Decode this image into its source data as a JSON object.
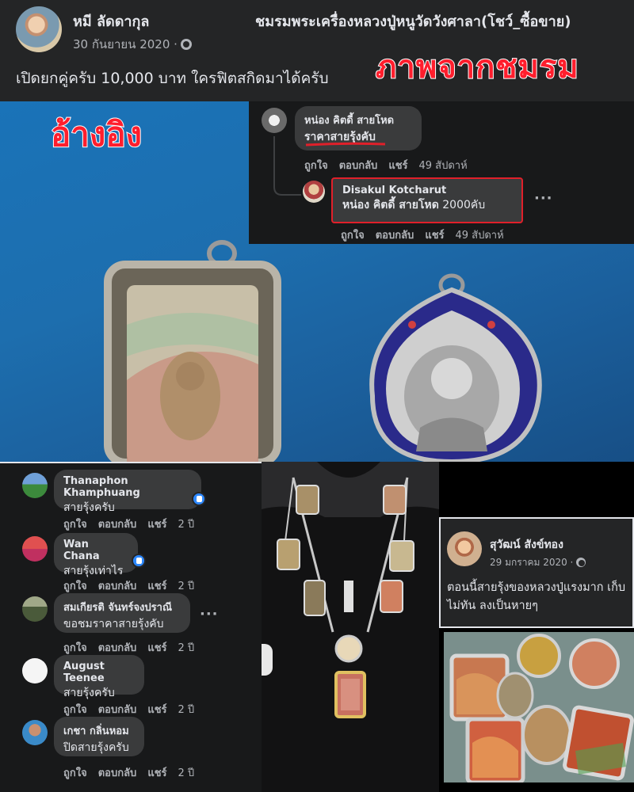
{
  "top_post": {
    "author": "หมี ลัดดากุล",
    "date": "30 กันยายน 2020 ·",
    "group": "ชมรมพระเครื่องหลวงปู่หนูวัดวังศาลา(โชว์_ซื้อขาย)",
    "text": "เปิดยกคู่ครับ 10,000 บาท ใครฟิตสกิดมาได้ครับ",
    "overlay_label": "ภาพจากชมรม"
  },
  "main_photo": {
    "overlay_label": "อ้างอิง"
  },
  "top_comments": [
    {
      "name": "หน่อง คิตดี้ สายโหด",
      "message": "ราคาสายรุ้งคับ",
      "actions": [
        "ถูกใจ",
        "ตอบกลับ",
        "แชร์"
      ],
      "time": "49 สัปดาห์"
    },
    {
      "name": "Disakul Kotcharut",
      "mention": "หน่อง คิตดี้ สายโหด",
      "message": "2000คับ",
      "actions": [
        "ถูกใจ",
        "ตอบกลับ",
        "แชร์"
      ],
      "time": "49 สัปดาห์"
    }
  ],
  "left_comments": [
    {
      "name": "Thanaphon Khamphuang",
      "message": "สายรุ้งครับ",
      "actions": [
        "ถูกใจ",
        "ตอบกลับ",
        "แชร์"
      ],
      "time": "2 ปี",
      "reaction": "like-icon"
    },
    {
      "name": "Wan Chana",
      "message": "สายรุ้งเท่าไร",
      "actions": [
        "ถูกใจ",
        "ตอบกลับ",
        "แชร์"
      ],
      "time": "2 ปี",
      "reaction": "like-icon"
    },
    {
      "name": "สมเกียรติ จันทร์จงปราณี",
      "message": "ขอชมราคาสายรุ้งคับ",
      "actions": [
        "ถูกใจ",
        "ตอบกลับ",
        "แชร์"
      ],
      "time": "2 ปี"
    },
    {
      "name": "August Teenee",
      "message": "สายรุ้งครับ",
      "actions": [
        "ถูกใจ",
        "ตอบกลับ",
        "แชร์"
      ],
      "time": "2 ปี"
    },
    {
      "name": "เกชา กลิ่นหอม",
      "message": "ปิดสายรุ้งครับ",
      "actions": [
        "ถูกใจ",
        "ตอบกลับ",
        "แชร์"
      ],
      "time": "2 ปี"
    }
  ],
  "right_post": {
    "author": "สุวัฒน์ สังข์ทอง",
    "date": "29 มกราคม 2020 ·",
    "text": "ตอนนี้สายรุ้งของหลวงปู่แรงมาก เก็บไม่ทัน ลงเป็นหายๆ"
  },
  "colors": {
    "bg": "#18191a",
    "card": "#242526",
    "bubble": "#3a3b3c",
    "text": "#e4e6eb",
    "muted": "#b0b3b8",
    "highlight_red": "#ff1e2d",
    "like_blue": "#2d88ff"
  }
}
